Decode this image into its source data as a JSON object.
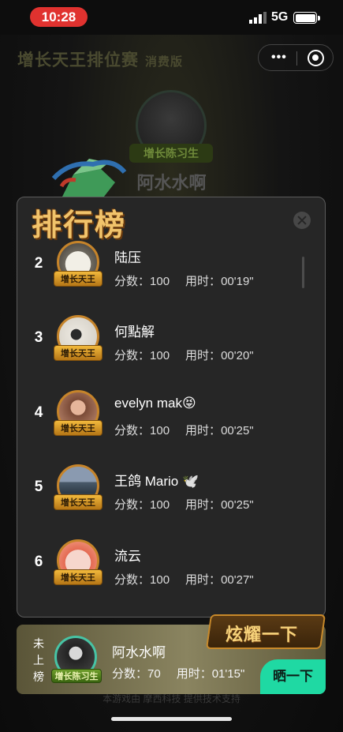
{
  "status_bar": {
    "time": "10:28",
    "network": "5G"
  },
  "background": {
    "title": "增长天王排位赛",
    "title_suffix": "消费版",
    "badge": "增长陈习生",
    "name": "阿水水啊",
    "footer": "本游戏由 摩西科技 提供技术支持"
  },
  "leaderboard": {
    "title": "排行榜",
    "tag_label": "增长天王",
    "stats_score_label": "分数：",
    "stats_time_label": "用时：",
    "rows": [
      {
        "rank": "2",
        "name": "陆压",
        "score": "100",
        "time": "00'19\""
      },
      {
        "rank": "3",
        "name": "何點解",
        "score": "100",
        "time": "00'20\""
      },
      {
        "rank": "4",
        "name": "evelyn mak😝",
        "score": "100",
        "time": "00'25\""
      },
      {
        "rank": "5",
        "name": "王鸽 Mario 🕊️",
        "score": "100",
        "time": "00'25\""
      },
      {
        "rank": "6",
        "name": "流云",
        "score": "100",
        "time": "00'27\""
      }
    ]
  },
  "my_rank": {
    "status": "未上榜",
    "status_chars": [
      "未",
      "上",
      "榜"
    ],
    "tag_label": "增长陈习生",
    "name": "阿水水啊",
    "score_label": "分数：",
    "score": "70",
    "time_label": "用时：",
    "time": "01'15\"",
    "show_off_label": "炫耀一下",
    "share_button": "晒一下"
  },
  "colors": {
    "accent": "#1fd9a3",
    "badge_gold": "#c6842a",
    "status_red": "#e0322f"
  }
}
